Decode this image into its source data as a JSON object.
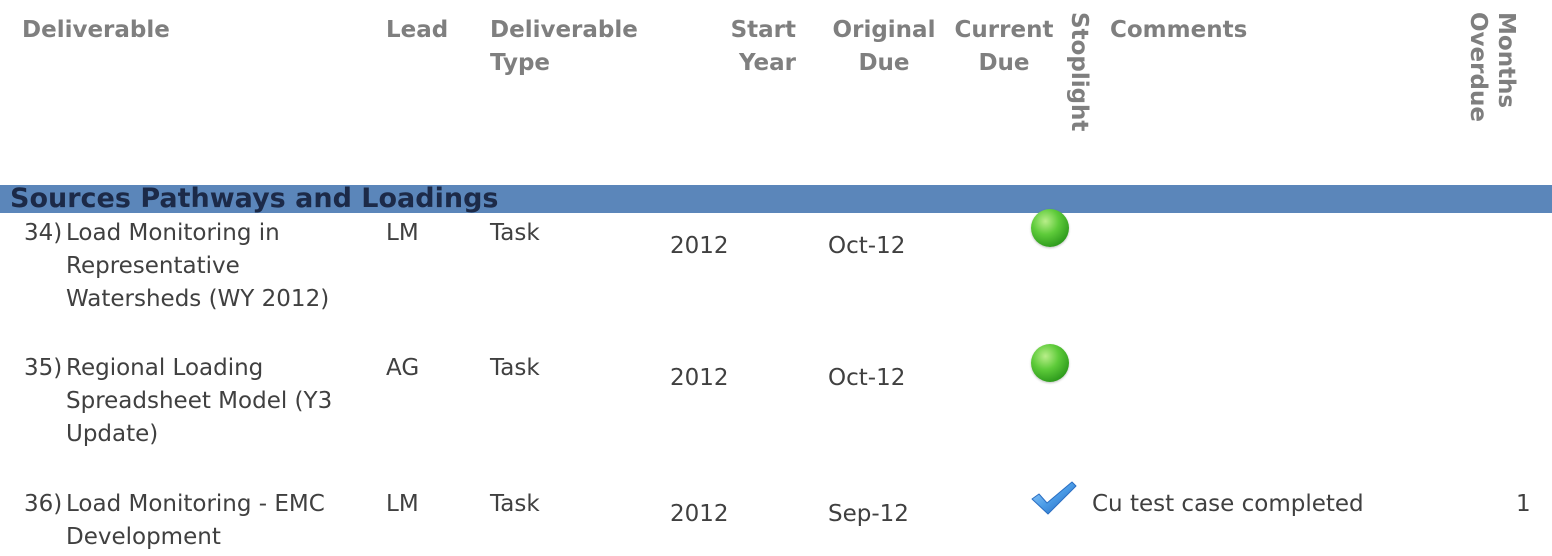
{
  "headers": {
    "deliverable": "Deliverable",
    "lead": "Lead",
    "type_line1": "Deliverable",
    "type_line2": "Type",
    "start_line1": "Start",
    "start_line2": "Year",
    "orig_line1": "Original",
    "orig_line2": "Due",
    "curr_line1": "Current",
    "curr_line2": "Due",
    "stoplight": "Stoplight",
    "comments": "Comments",
    "months_line1": "Months",
    "months_line2": "Overdue"
  },
  "section": {
    "title": "Sources Pathways and Loadings"
  },
  "rows": [
    {
      "num": "34)",
      "deliverable_lines": [
        "Load Monitoring in",
        "Representative",
        "Watersheds (WY 2012)"
      ],
      "lead": "LM",
      "type": "Task",
      "start_year": "2012",
      "original_due": "Oct-12",
      "current_due": "",
      "status": "green-circle",
      "comments": "",
      "months_overdue": ""
    },
    {
      "num": "35)",
      "deliverable_lines": [
        "Regional Loading",
        "Spreadsheet Model (Y3",
        "Update)"
      ],
      "lead": "AG",
      "type": "Task",
      "start_year": "2012",
      "original_due": "Oct-12",
      "current_due": "",
      "status": "green-circle",
      "comments": "",
      "months_overdue": ""
    },
    {
      "num": "36)",
      "deliverable_lines": [
        "Load Monitoring - EMC",
        "Development"
      ],
      "lead": "LM",
      "type": "Task",
      "start_year": "2012",
      "original_due": "Sep-12",
      "current_due": "",
      "status": "blue-checkmark",
      "comments": "Cu test case completed",
      "months_overdue": "1"
    }
  ],
  "colors": {
    "header_text": "#7f7f7f",
    "section_bar": "#5b86ba",
    "section_text": "#1c2a48",
    "body_text": "#404040",
    "status_green": "#3fb62a",
    "check_blue": "#3a86d8"
  }
}
